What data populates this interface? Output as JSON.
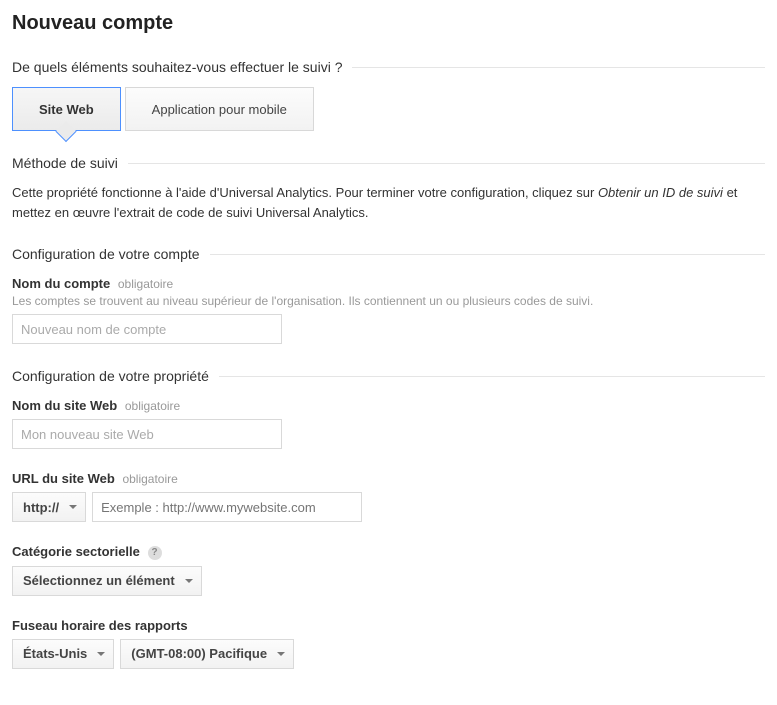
{
  "title": "Nouveau compte",
  "tracking": {
    "question": "De quels éléments souhaitez-vous effectuer le suivi ?",
    "tabs": {
      "website": "Site Web",
      "mobile": "Application pour mobile"
    }
  },
  "method": {
    "heading": "Méthode de suivi",
    "text_before": "Cette propriété fonctionne à l'aide d'Universal Analytics. Pour terminer votre configuration, cliquez sur ",
    "italic": "Obtenir un ID de suivi",
    "text_after": " et mettez en œuvre l'extrait de code de suivi Universal Analytics."
  },
  "account": {
    "heading": "Configuration de votre compte",
    "name_label": "Nom du compte",
    "required": "obligatoire",
    "hint": "Les comptes se trouvent au niveau supérieur de l'organisation. Ils contiennent un ou plusieurs codes de suivi.",
    "placeholder": "Nouveau nom de compte"
  },
  "property": {
    "heading": "Configuration de votre propriété",
    "site_name_label": "Nom du site Web",
    "required": "obligatoire",
    "site_name_placeholder": "Mon nouveau site Web",
    "url_label": "URL du site Web",
    "url_scheme": "http://",
    "url_placeholder": "Exemple : http://www.mywebsite.com",
    "category_label": "Catégorie sectorielle",
    "category_value": "Sélectionnez un élément",
    "timezone_label": "Fuseau horaire des rapports",
    "country_value": "États-Unis",
    "tz_value": "(GMT-08:00) Pacifique"
  }
}
